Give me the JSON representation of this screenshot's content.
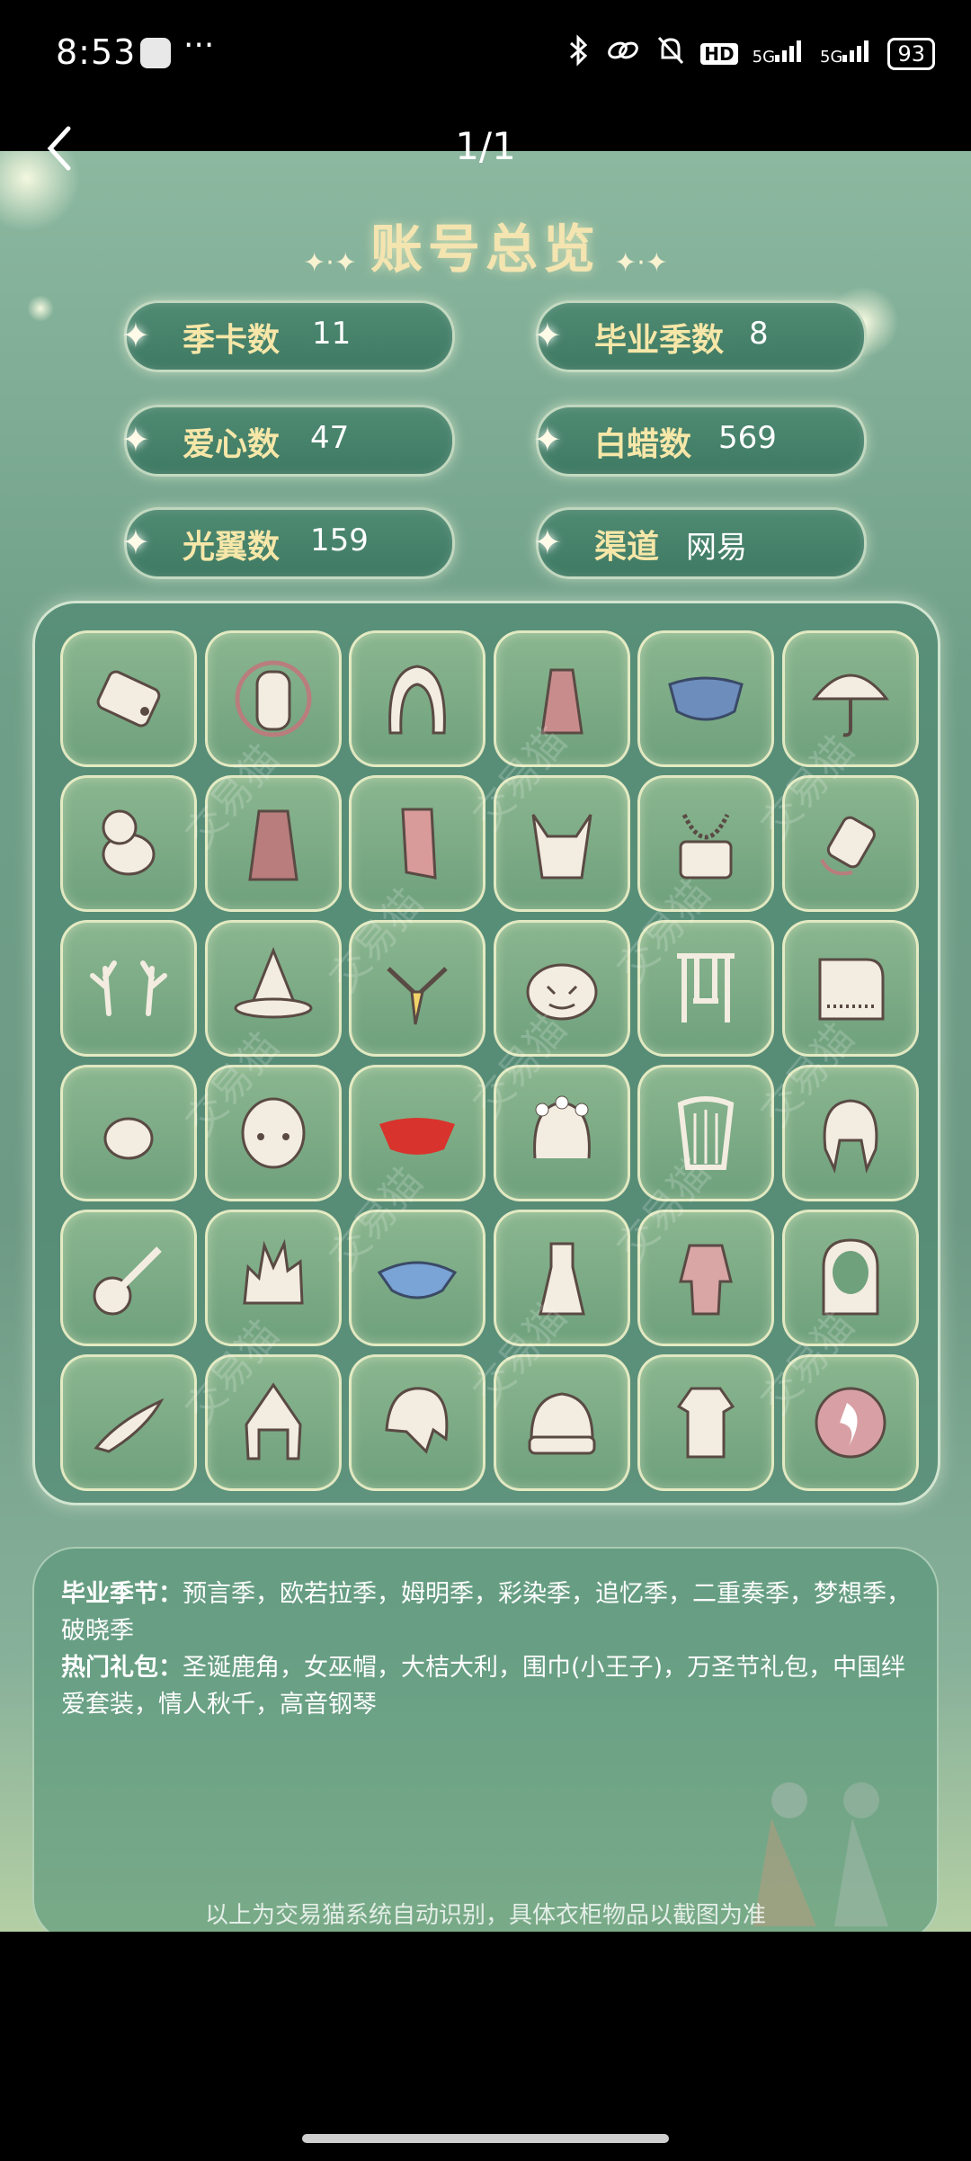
{
  "status_bar": {
    "time": "8:53",
    "battery": "93",
    "network1": "5G",
    "network2": "5G",
    "hd": "HD",
    "more": "···"
  },
  "nav": {
    "page_counter": "1/1"
  },
  "overview": {
    "title": "账号总览",
    "stats": [
      {
        "label": "季卡数",
        "value": "11"
      },
      {
        "label": "毕业季数",
        "value": "8"
      },
      {
        "label": "爱心数",
        "value": "47"
      },
      {
        "label": "白蜡数",
        "value": "569"
      },
      {
        "label": "光翼数",
        "value": "159"
      },
      {
        "label": "渠道",
        "value": "网易"
      }
    ]
  },
  "items": [
    {
      "icon": "scroll-icon",
      "color": "#f3ece0"
    },
    {
      "icon": "mask-icon",
      "color": "#f3ece0"
    },
    {
      "icon": "hood-hair-icon",
      "color": "#f3ece0"
    },
    {
      "icon": "robe-icon",
      "color": "#c98c8c"
    },
    {
      "icon": "cape-icon",
      "color": "#6d8dbd"
    },
    {
      "icon": "umbrella-icon",
      "color": "#f3ece0"
    },
    {
      "icon": "moomin-icon",
      "color": "#f3ece0"
    },
    {
      "icon": "coat-icon",
      "color": "#b97d7d"
    },
    {
      "icon": "cape-red-icon",
      "color": "#d99a9a"
    },
    {
      "icon": "horned-mask-icon",
      "color": "#f3ece0"
    },
    {
      "icon": "necklace-icon",
      "color": "#f3ece0"
    },
    {
      "icon": "relic-mask-icon",
      "color": "#f3ece0"
    },
    {
      "icon": "antlers-icon",
      "color": "#f3ece0"
    },
    {
      "icon": "witch-hat-icon",
      "color": "#f3ece0"
    },
    {
      "icon": "scarf-icon",
      "color": "#f2d36a"
    },
    {
      "icon": "pumpkin-icon",
      "color": "#f3ece0"
    },
    {
      "icon": "swing-icon",
      "color": "#f3ece0"
    },
    {
      "icon": "piano-icon",
      "color": "#f3ece0"
    },
    {
      "icon": "peach-icon",
      "color": "#f3ece0"
    },
    {
      "icon": "round-mask-icon",
      "color": "#f3ece0"
    },
    {
      "icon": "red-cape-icon",
      "color": "#d8332c"
    },
    {
      "icon": "flower-crown-icon",
      "color": "#f3ece0"
    },
    {
      "icon": "harp-icon",
      "color": "#f3ece0"
    },
    {
      "icon": "braids-hair-icon",
      "color": "#f3ece0"
    },
    {
      "icon": "guitar-icon",
      "color": "#f3ece0"
    },
    {
      "icon": "spiky-hair-icon",
      "color": "#f3ece0"
    },
    {
      "icon": "blue-cape-icon",
      "color": "#7aa3d6"
    },
    {
      "icon": "dress-icon",
      "color": "#f3ece0"
    },
    {
      "icon": "outfit-icon",
      "color": "#d9a5a5"
    },
    {
      "icon": "hood-icon",
      "color": "#f3ece0"
    },
    {
      "icon": "horn-icon",
      "color": "#f3ece0"
    },
    {
      "icon": "pointed-hood-icon",
      "color": "#f3ece0"
    },
    {
      "icon": "short-hair-icon",
      "color": "#f3ece0"
    },
    {
      "icon": "knit-hat-icon",
      "color": "#f3ece0"
    },
    {
      "icon": "shirt-icon",
      "color": "#f3ece0"
    },
    {
      "icon": "flame-mask-icon",
      "color": "#d8a0a4"
    }
  ],
  "info": {
    "graduated_label": "毕业季节：",
    "graduated_text": "预言季，欧若拉季，姆明季，彩染季，追忆季，二重奏季，梦想季，破晓季",
    "hot_label": "热门礼包：",
    "hot_text": "圣诞鹿角，女巫帽，大桔大利，围巾(小王子)，万圣节礼包，中国绊爱套装，情人秋千，高音钢琴",
    "footer": "以上为交易猫系统自动识别，具体衣柜物品以截图为准"
  },
  "watermark": "交易猫"
}
